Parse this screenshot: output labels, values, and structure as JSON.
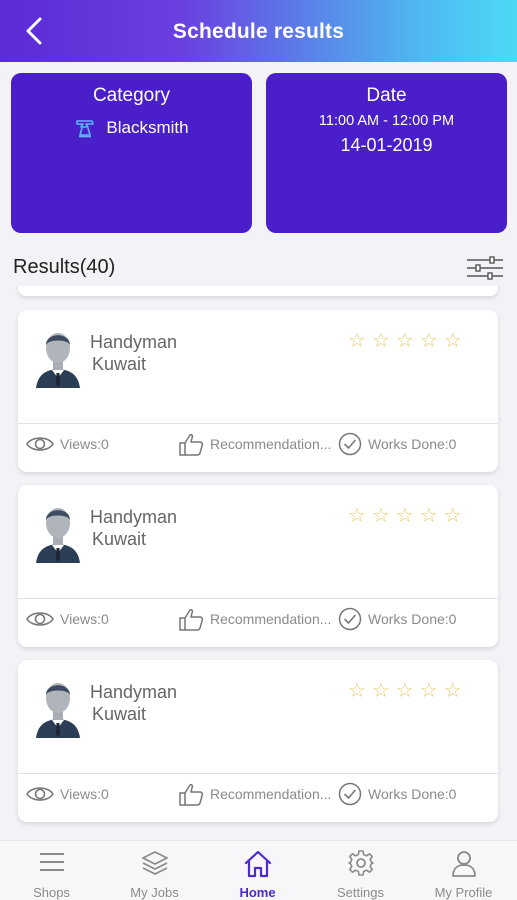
{
  "header": {
    "title": "Schedule results",
    "back_icon": "chevron-left-icon"
  },
  "category_card": {
    "label": "Category",
    "value": "Blacksmith",
    "icon": "anvil-icon"
  },
  "date_card": {
    "label": "Date",
    "time_range": "11:00 AM - 12:00 PM",
    "date": "14-01-2019"
  },
  "results": {
    "label": "Results(40)",
    "filter_icon": "sliders-icon",
    "items": [
      {
        "name": "Handyman",
        "location": "Kuwait",
        "rating": 0,
        "rating_max": 5,
        "views": "Views:0",
        "recommendations": "Recommendation...",
        "works_done": "Works Done:0"
      },
      {
        "name": "Handyman",
        "location": "Kuwait",
        "rating": 0,
        "rating_max": 5,
        "views": "Views:0",
        "recommendations": "Recommendation...",
        "works_done": "Works Done:0"
      },
      {
        "name": "Handyman",
        "location": "Kuwait",
        "rating": 0,
        "rating_max": 5,
        "views": "Views:0",
        "recommendations": "Recommendation...",
        "works_done": "Works Done:0"
      }
    ]
  },
  "tabbar": {
    "tabs": [
      {
        "label": "Shops",
        "icon": "menu-icon",
        "active": false
      },
      {
        "label": "My Jobs",
        "icon": "layers-icon",
        "active": false
      },
      {
        "label": "Home",
        "icon": "home-icon",
        "active": true
      },
      {
        "label": "Settings",
        "icon": "gear-icon",
        "active": false
      },
      {
        "label": "My Profile",
        "icon": "user-icon",
        "active": false
      }
    ]
  },
  "colors": {
    "header_gradient_start": "#5b2bd6",
    "header_gradient_end": "#4dd9f7",
    "card_purple": "#4a1fc9",
    "star_color": "#e8c96a",
    "active_tab": "#4a2bd2",
    "inactive_tab": "#8b8b8b"
  }
}
